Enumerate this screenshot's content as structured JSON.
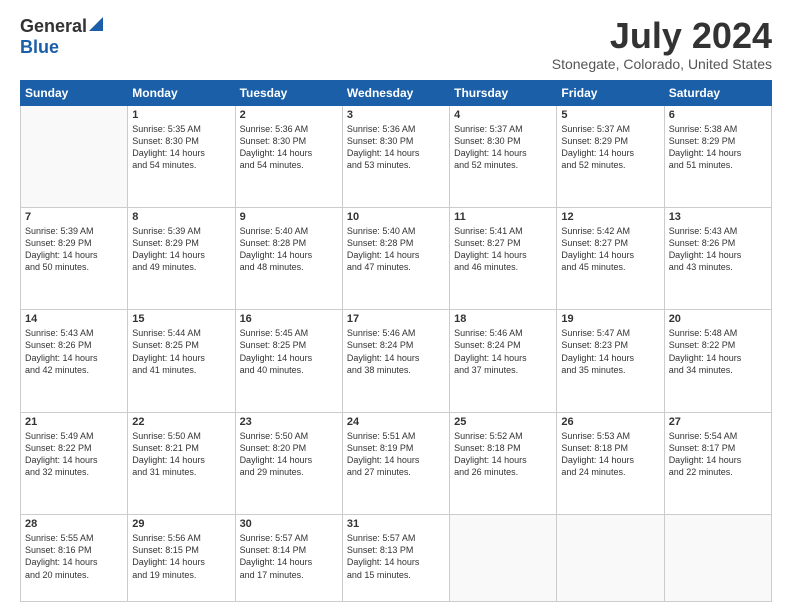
{
  "header": {
    "logo_general": "General",
    "logo_blue": "Blue",
    "title": "July 2024",
    "location": "Stonegate, Colorado, United States"
  },
  "days_of_week": [
    "Sunday",
    "Monday",
    "Tuesday",
    "Wednesday",
    "Thursday",
    "Friday",
    "Saturday"
  ],
  "weeks": [
    [
      {
        "day": "",
        "content": ""
      },
      {
        "day": "1",
        "content": "Sunrise: 5:35 AM\nSunset: 8:30 PM\nDaylight: 14 hours\nand 54 minutes."
      },
      {
        "day": "2",
        "content": "Sunrise: 5:36 AM\nSunset: 8:30 PM\nDaylight: 14 hours\nand 54 minutes."
      },
      {
        "day": "3",
        "content": "Sunrise: 5:36 AM\nSunset: 8:30 PM\nDaylight: 14 hours\nand 53 minutes."
      },
      {
        "day": "4",
        "content": "Sunrise: 5:37 AM\nSunset: 8:30 PM\nDaylight: 14 hours\nand 52 minutes."
      },
      {
        "day": "5",
        "content": "Sunrise: 5:37 AM\nSunset: 8:29 PM\nDaylight: 14 hours\nand 52 minutes."
      },
      {
        "day": "6",
        "content": "Sunrise: 5:38 AM\nSunset: 8:29 PM\nDaylight: 14 hours\nand 51 minutes."
      }
    ],
    [
      {
        "day": "7",
        "content": "Sunrise: 5:39 AM\nSunset: 8:29 PM\nDaylight: 14 hours\nand 50 minutes."
      },
      {
        "day": "8",
        "content": "Sunrise: 5:39 AM\nSunset: 8:29 PM\nDaylight: 14 hours\nand 49 minutes."
      },
      {
        "day": "9",
        "content": "Sunrise: 5:40 AM\nSunset: 8:28 PM\nDaylight: 14 hours\nand 48 minutes."
      },
      {
        "day": "10",
        "content": "Sunrise: 5:40 AM\nSunset: 8:28 PM\nDaylight: 14 hours\nand 47 minutes."
      },
      {
        "day": "11",
        "content": "Sunrise: 5:41 AM\nSunset: 8:27 PM\nDaylight: 14 hours\nand 46 minutes."
      },
      {
        "day": "12",
        "content": "Sunrise: 5:42 AM\nSunset: 8:27 PM\nDaylight: 14 hours\nand 45 minutes."
      },
      {
        "day": "13",
        "content": "Sunrise: 5:43 AM\nSunset: 8:26 PM\nDaylight: 14 hours\nand 43 minutes."
      }
    ],
    [
      {
        "day": "14",
        "content": "Sunrise: 5:43 AM\nSunset: 8:26 PM\nDaylight: 14 hours\nand 42 minutes."
      },
      {
        "day": "15",
        "content": "Sunrise: 5:44 AM\nSunset: 8:25 PM\nDaylight: 14 hours\nand 41 minutes."
      },
      {
        "day": "16",
        "content": "Sunrise: 5:45 AM\nSunset: 8:25 PM\nDaylight: 14 hours\nand 40 minutes."
      },
      {
        "day": "17",
        "content": "Sunrise: 5:46 AM\nSunset: 8:24 PM\nDaylight: 14 hours\nand 38 minutes."
      },
      {
        "day": "18",
        "content": "Sunrise: 5:46 AM\nSunset: 8:24 PM\nDaylight: 14 hours\nand 37 minutes."
      },
      {
        "day": "19",
        "content": "Sunrise: 5:47 AM\nSunset: 8:23 PM\nDaylight: 14 hours\nand 35 minutes."
      },
      {
        "day": "20",
        "content": "Sunrise: 5:48 AM\nSunset: 8:22 PM\nDaylight: 14 hours\nand 34 minutes."
      }
    ],
    [
      {
        "day": "21",
        "content": "Sunrise: 5:49 AM\nSunset: 8:22 PM\nDaylight: 14 hours\nand 32 minutes."
      },
      {
        "day": "22",
        "content": "Sunrise: 5:50 AM\nSunset: 8:21 PM\nDaylight: 14 hours\nand 31 minutes."
      },
      {
        "day": "23",
        "content": "Sunrise: 5:50 AM\nSunset: 8:20 PM\nDaylight: 14 hours\nand 29 minutes."
      },
      {
        "day": "24",
        "content": "Sunrise: 5:51 AM\nSunset: 8:19 PM\nDaylight: 14 hours\nand 27 minutes."
      },
      {
        "day": "25",
        "content": "Sunrise: 5:52 AM\nSunset: 8:18 PM\nDaylight: 14 hours\nand 26 minutes."
      },
      {
        "day": "26",
        "content": "Sunrise: 5:53 AM\nSunset: 8:18 PM\nDaylight: 14 hours\nand 24 minutes."
      },
      {
        "day": "27",
        "content": "Sunrise: 5:54 AM\nSunset: 8:17 PM\nDaylight: 14 hours\nand 22 minutes."
      }
    ],
    [
      {
        "day": "28",
        "content": "Sunrise: 5:55 AM\nSunset: 8:16 PM\nDaylight: 14 hours\nand 20 minutes."
      },
      {
        "day": "29",
        "content": "Sunrise: 5:56 AM\nSunset: 8:15 PM\nDaylight: 14 hours\nand 19 minutes."
      },
      {
        "day": "30",
        "content": "Sunrise: 5:57 AM\nSunset: 8:14 PM\nDaylight: 14 hours\nand 17 minutes."
      },
      {
        "day": "31",
        "content": "Sunrise: 5:57 AM\nSunset: 8:13 PM\nDaylight: 14 hours\nand 15 minutes."
      },
      {
        "day": "",
        "content": ""
      },
      {
        "day": "",
        "content": ""
      },
      {
        "day": "",
        "content": ""
      }
    ]
  ]
}
